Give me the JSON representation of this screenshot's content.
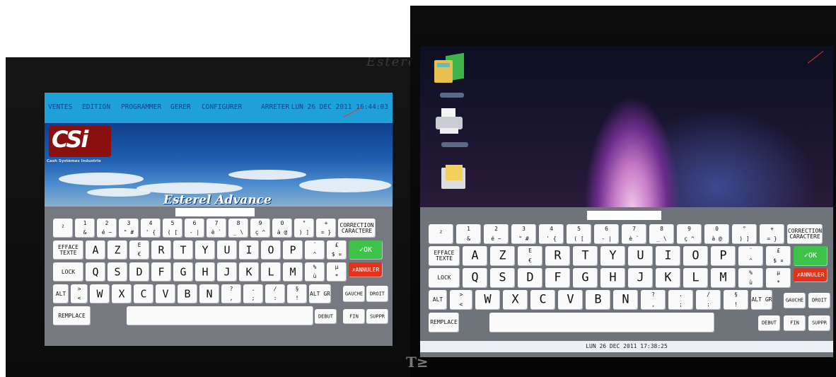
{
  "photo_left": {
    "bezel_text": "Esterel",
    "menu": [
      "VENTES",
      "EDITION",
      "PROGRAMMER",
      "GERER",
      "CONFIGURER",
      "ARRETER"
    ],
    "clock": "LUN 26 DEC 2011 16:44:03",
    "logo": {
      "text": "CSi",
      "subtitle": "Cash Systèmes Industrie"
    },
    "banner": "Esterel Advance"
  },
  "photo_right": {
    "status_clock": "LUN 26 DEC 2011 17:38:25"
  },
  "keyboard": {
    "row1": [
      {
        "top": "",
        "mid": "²"
      },
      {
        "top": "1",
        "bot": "&"
      },
      {
        "top": "2",
        "bot": "é  ~"
      },
      {
        "top": "3",
        "bot": "\"  #"
      },
      {
        "top": "4",
        "bot": "'  {"
      },
      {
        "top": "5",
        "bot": "(  ["
      },
      {
        "top": "6",
        "bot": "-  |"
      },
      {
        "top": "7",
        "bot": "è  `"
      },
      {
        "top": "8",
        "bot": "_  \\"
      },
      {
        "top": "9",
        "bot": "ç  ^"
      },
      {
        "top": "0",
        "bot": "à  @"
      },
      {
        "top": "°",
        "bot": ")  ]"
      },
      {
        "top": "+",
        "bot": "=  }"
      }
    ],
    "correction": "CORRECTION CARACTERE",
    "efface": "EFFACE TEXTE",
    "row2": [
      "A",
      "Z",
      "E",
      "R",
      "T",
      "Y",
      "U",
      "I",
      "O",
      "P"
    ],
    "row2_sub": [
      "",
      "",
      "€",
      "",
      "",
      "",
      "",
      "",
      "",
      ""
    ],
    "row2_extra": [
      {
        "top": "¨",
        "bot": "^"
      },
      {
        "top": "£",
        "bot": "$  ¤"
      }
    ],
    "ok": "OK",
    "lock": "LOCK",
    "row3": [
      "Q",
      "S",
      "D",
      "F",
      "G",
      "H",
      "J",
      "K",
      "L",
      "M"
    ],
    "row3_extra": [
      {
        "top": "%",
        "bot": "ù"
      },
      {
        "top": "µ",
        "bot": "*"
      }
    ],
    "annuler": "ANNULER",
    "alt": "ALT",
    "row4_first": {
      "top": ">",
      "bot": "<"
    },
    "row4": [
      "W",
      "X",
      "C",
      "V",
      "B",
      "N"
    ],
    "row4_extra": [
      {
        "top": "?",
        "bot": ","
      },
      {
        "top": ".",
        "bot": ";"
      },
      {
        "top": "/",
        "bot": ":"
      },
      {
        "top": "§",
        "bot": "!"
      }
    ],
    "altgr": "ALT GR",
    "gauche": "GAUCHE",
    "droit": "DROIT",
    "remplace": "REMPLACE",
    "debut": "DEBUT",
    "fin": "FIN",
    "suppr": "SUPPR"
  },
  "colors": {
    "menubar": "#1fa0d8",
    "menu_text": "#1b3a9e",
    "ok": "#3fc24a",
    "annuler": "#e0331a",
    "keyboard_bg": "#76797f"
  }
}
